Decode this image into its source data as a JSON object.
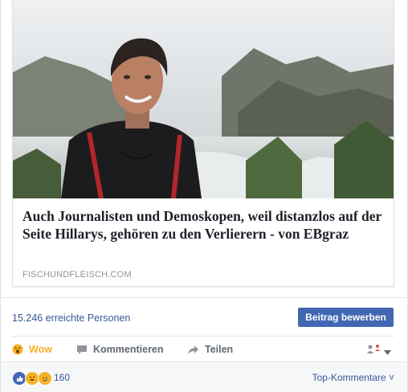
{
  "link": {
    "title": "Auch Journalisten und Demoskopen, weil distanzlos auf der Seite Hillarys, gehören zu den Verlierern - von EBgraz",
    "domain": "FISCHUNDFLEISCH.COM"
  },
  "reach": {
    "text": "15.246 erreichte Personen",
    "boost_label": "Beitrag bewerben"
  },
  "actions": {
    "wow": "Wow",
    "comment": "Kommentieren",
    "share": "Teilen"
  },
  "footer": {
    "reaction_count": "160",
    "top_comments": "Top-Kommentare ˅"
  },
  "colors": {
    "link_blue": "#365899",
    "button_blue": "#4267b2",
    "wow_yellow": "#f7b125",
    "border": "#dddfe2"
  },
  "icons": {
    "wow": "wow-emoji-icon",
    "comment": "comment-bubble-icon",
    "share": "share-arrow-icon",
    "audience": "page-audience-icon",
    "dropdown": "chevron-down-icon"
  }
}
